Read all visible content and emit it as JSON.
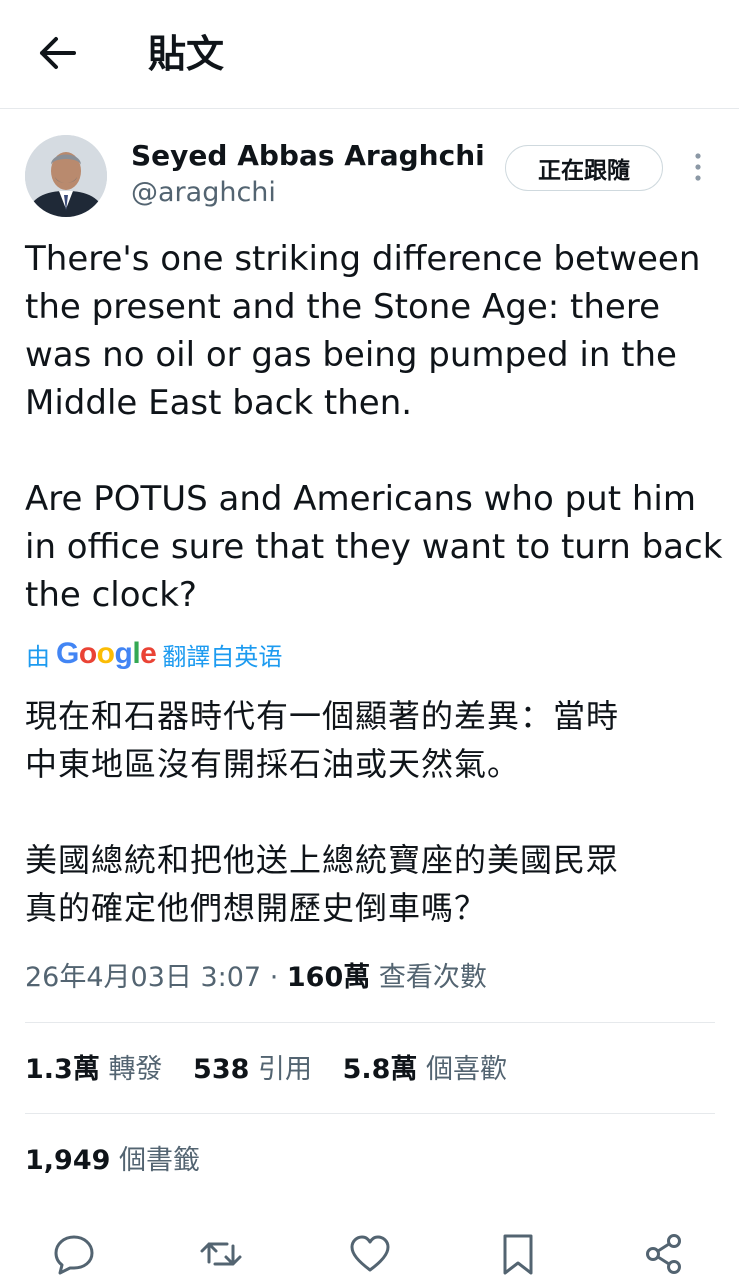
{
  "header": {
    "title": "貼文"
  },
  "post": {
    "author_name": "Seyed Abbas Araghchi",
    "handle": "@araghchi",
    "follow_label": "正在跟隨",
    "text_en_p1": "There's one striking difference between\nthe present and the Stone Age: there\nwas no oil or gas being pumped in the\nMiddle East back then.",
    "text_en_p2": "Are POTUS and Americans who put him\nin office sure that they want to turn back\nthe clock?",
    "translation": {
      "prefix": "由",
      "brand": "Google",
      "suffix": "翻譯自英语"
    },
    "text_zh_p1": "現在和石器時代有一個顯著的差異：當時\n中東地區沒有開採石油或天然氣。",
    "text_zh_p2": "美國總統和把他送上總統寶座的美國民眾\n真的確定他們想開歷史倒車嗎？",
    "timestamp": "26年4月03日 3:07",
    "separator": "·",
    "views_count": "160萬",
    "views_label": "查看次數"
  },
  "stats": {
    "retweets": {
      "count": "1.3萬",
      "label": "轉發"
    },
    "quotes": {
      "count": "538",
      "label": "引用"
    },
    "likes": {
      "count": "5.8萬",
      "label": "個喜歡"
    },
    "bookmarks": {
      "count": "1,949",
      "label": "個書籤"
    }
  },
  "icons": [
    "back-arrow-icon",
    "more-vertical-icon",
    "reply-icon",
    "retweet-icon",
    "like-icon",
    "bookmark-icon",
    "share-icon"
  ],
  "colors": {
    "link": "#1d9bf0",
    "secondary_text": "#536471",
    "divider": "#e6e9ec",
    "google_blue": "#4285F4",
    "google_red": "#EA4335",
    "google_yellow": "#FBBC05",
    "google_green": "#34A853"
  }
}
